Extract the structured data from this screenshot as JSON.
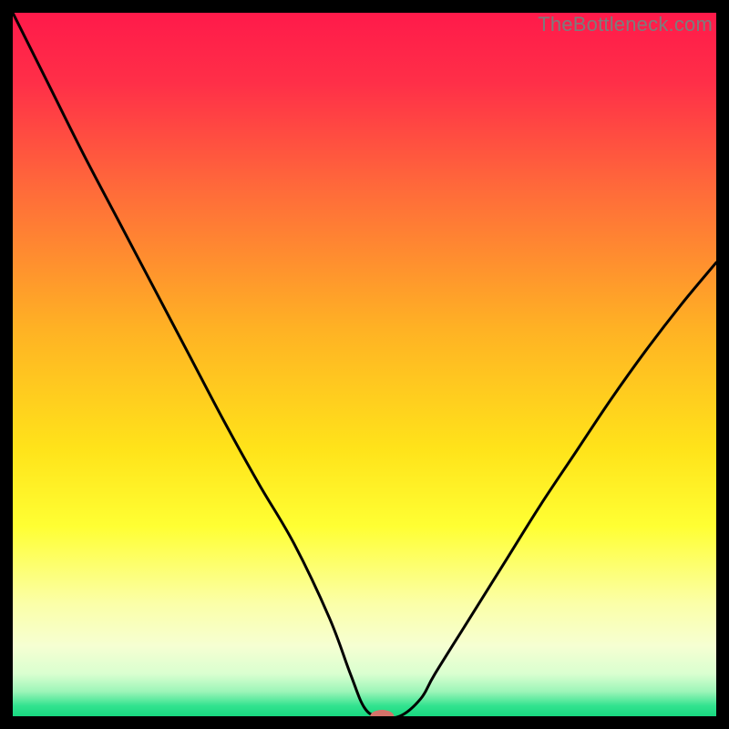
{
  "watermark": "TheBottleneck.com",
  "colors": {
    "frame": "#000000",
    "curve": "#000000",
    "marker_fill": "#d5726a",
    "gradient_stops": [
      {
        "offset": 0.0,
        "color": "#ff1a4a"
      },
      {
        "offset": 0.1,
        "color": "#ff2f48"
      },
      {
        "offset": 0.25,
        "color": "#ff6a3a"
      },
      {
        "offset": 0.45,
        "color": "#ffb224"
      },
      {
        "offset": 0.62,
        "color": "#ffe31a"
      },
      {
        "offset": 0.73,
        "color": "#ffff33"
      },
      {
        "offset": 0.84,
        "color": "#fbffa8"
      },
      {
        "offset": 0.9,
        "color": "#f6ffd2"
      },
      {
        "offset": 0.94,
        "color": "#d9ffd0"
      },
      {
        "offset": 0.965,
        "color": "#9cf5b8"
      },
      {
        "offset": 0.985,
        "color": "#33e38f"
      },
      {
        "offset": 1.0,
        "color": "#17d880"
      }
    ]
  },
  "chart_data": {
    "type": "line",
    "title": "",
    "xlabel": "",
    "ylabel": "",
    "xlim": [
      0,
      100
    ],
    "ylim": [
      0,
      100
    ],
    "grid": false,
    "legend": false,
    "series": [
      {
        "name": "bottleneck-curve",
        "x": [
          0,
          5,
          10,
          15,
          20,
          25,
          30,
          35,
          40,
          45,
          48,
          50,
          52,
          55,
          58,
          60,
          65,
          70,
          75,
          80,
          85,
          90,
          95,
          100
        ],
        "y": [
          100,
          90,
          80,
          70.5,
          61,
          51.5,
          42,
          33,
          24.5,
          14,
          6,
          1.2,
          0,
          0,
          2.5,
          6,
          14,
          22,
          30,
          37.5,
          45,
          52,
          58.5,
          64.5
        ]
      }
    ],
    "marker": {
      "x": 52.5,
      "y": 0,
      "rx": 1.7,
      "ry": 0.9
    },
    "note": "x/y are percent of plot area; y=0 at bottom, y=100 at top. Values estimated from pixels."
  }
}
